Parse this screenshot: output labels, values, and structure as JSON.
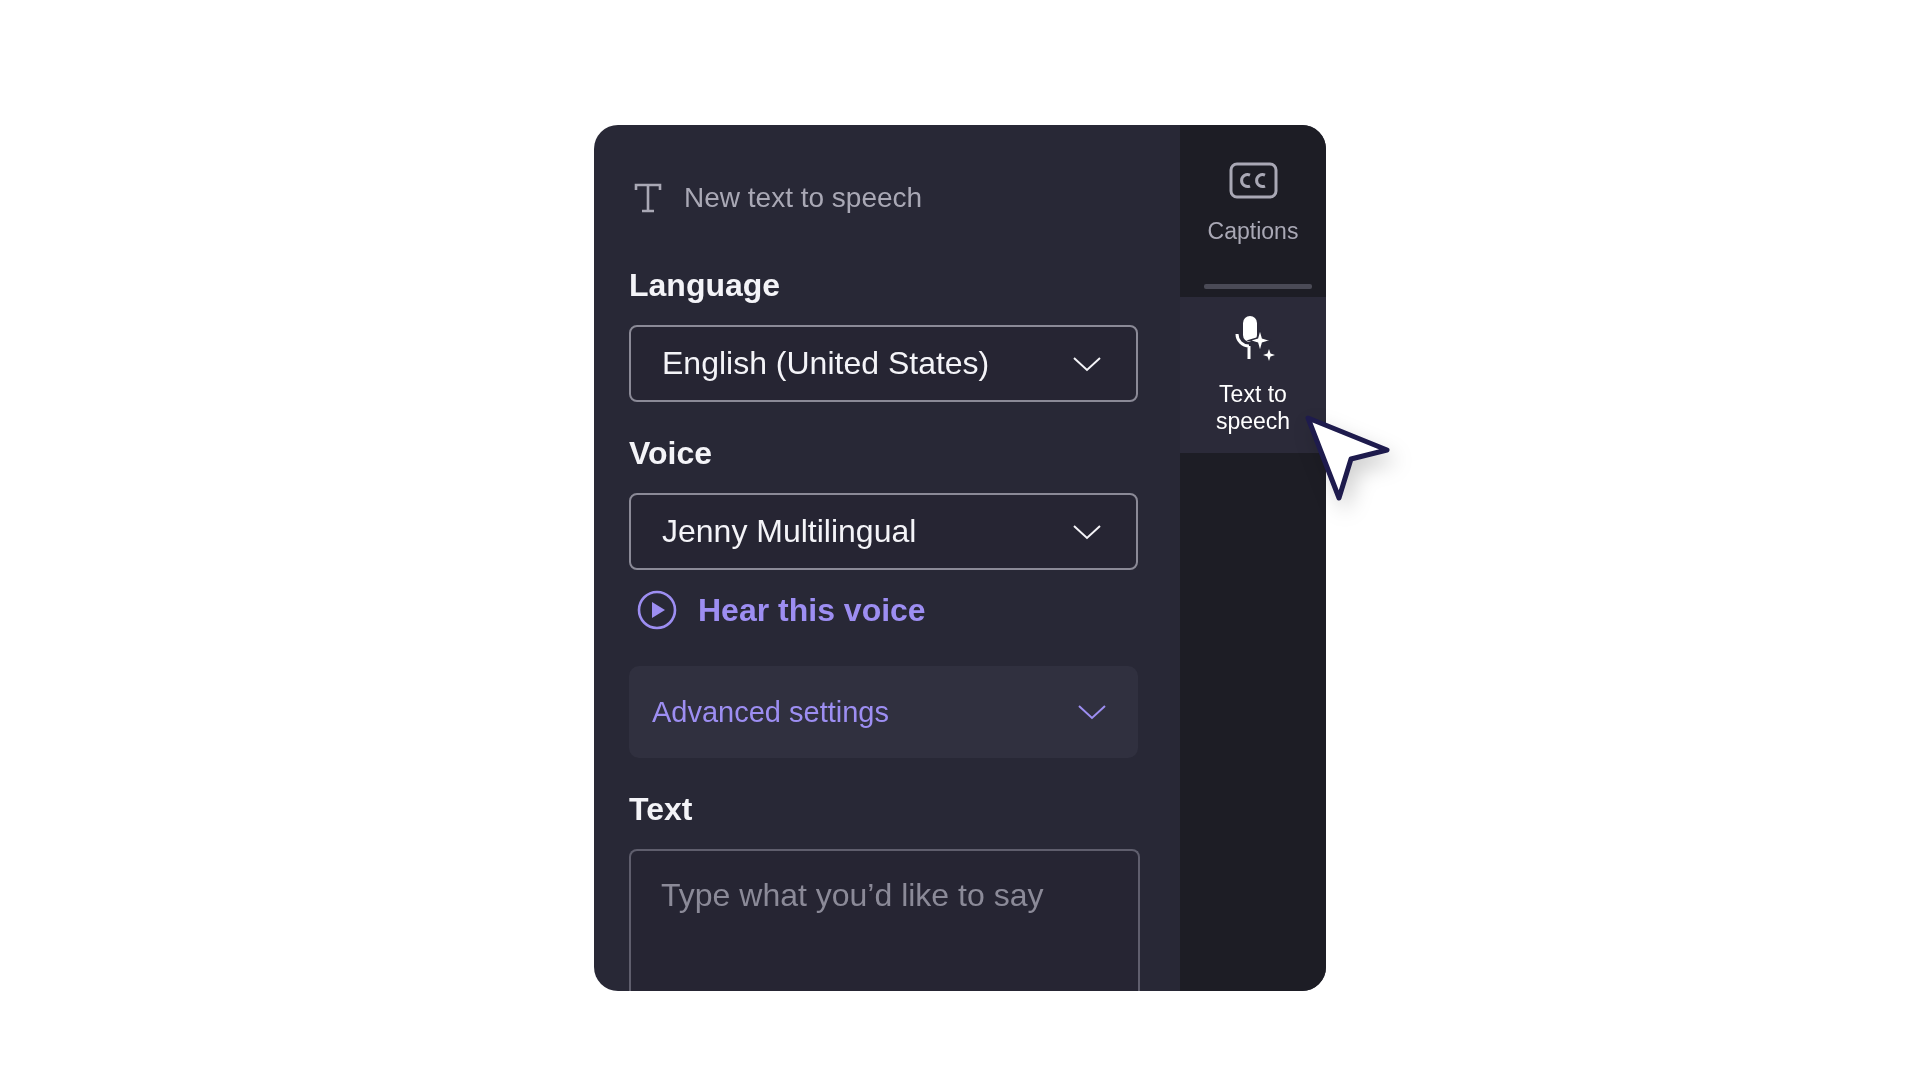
{
  "editor": {
    "title": "New text to speech",
    "language": {
      "label": "Language",
      "value": "English (United States)"
    },
    "voice": {
      "label": "Voice",
      "value": "Jenny Multilingual"
    },
    "hear_voice_link": "Hear this voice",
    "advanced_settings": {
      "label": "Advanced settings",
      "expanded": false
    },
    "text": {
      "label": "Text",
      "placeholder": "Type what you’d like to say"
    }
  },
  "sidebar": {
    "items": [
      {
        "kind": "captions",
        "label": "Captions",
        "selected": false
      },
      {
        "kind": "text_to_speech",
        "label": "Text to speech",
        "selected": true
      }
    ]
  }
}
